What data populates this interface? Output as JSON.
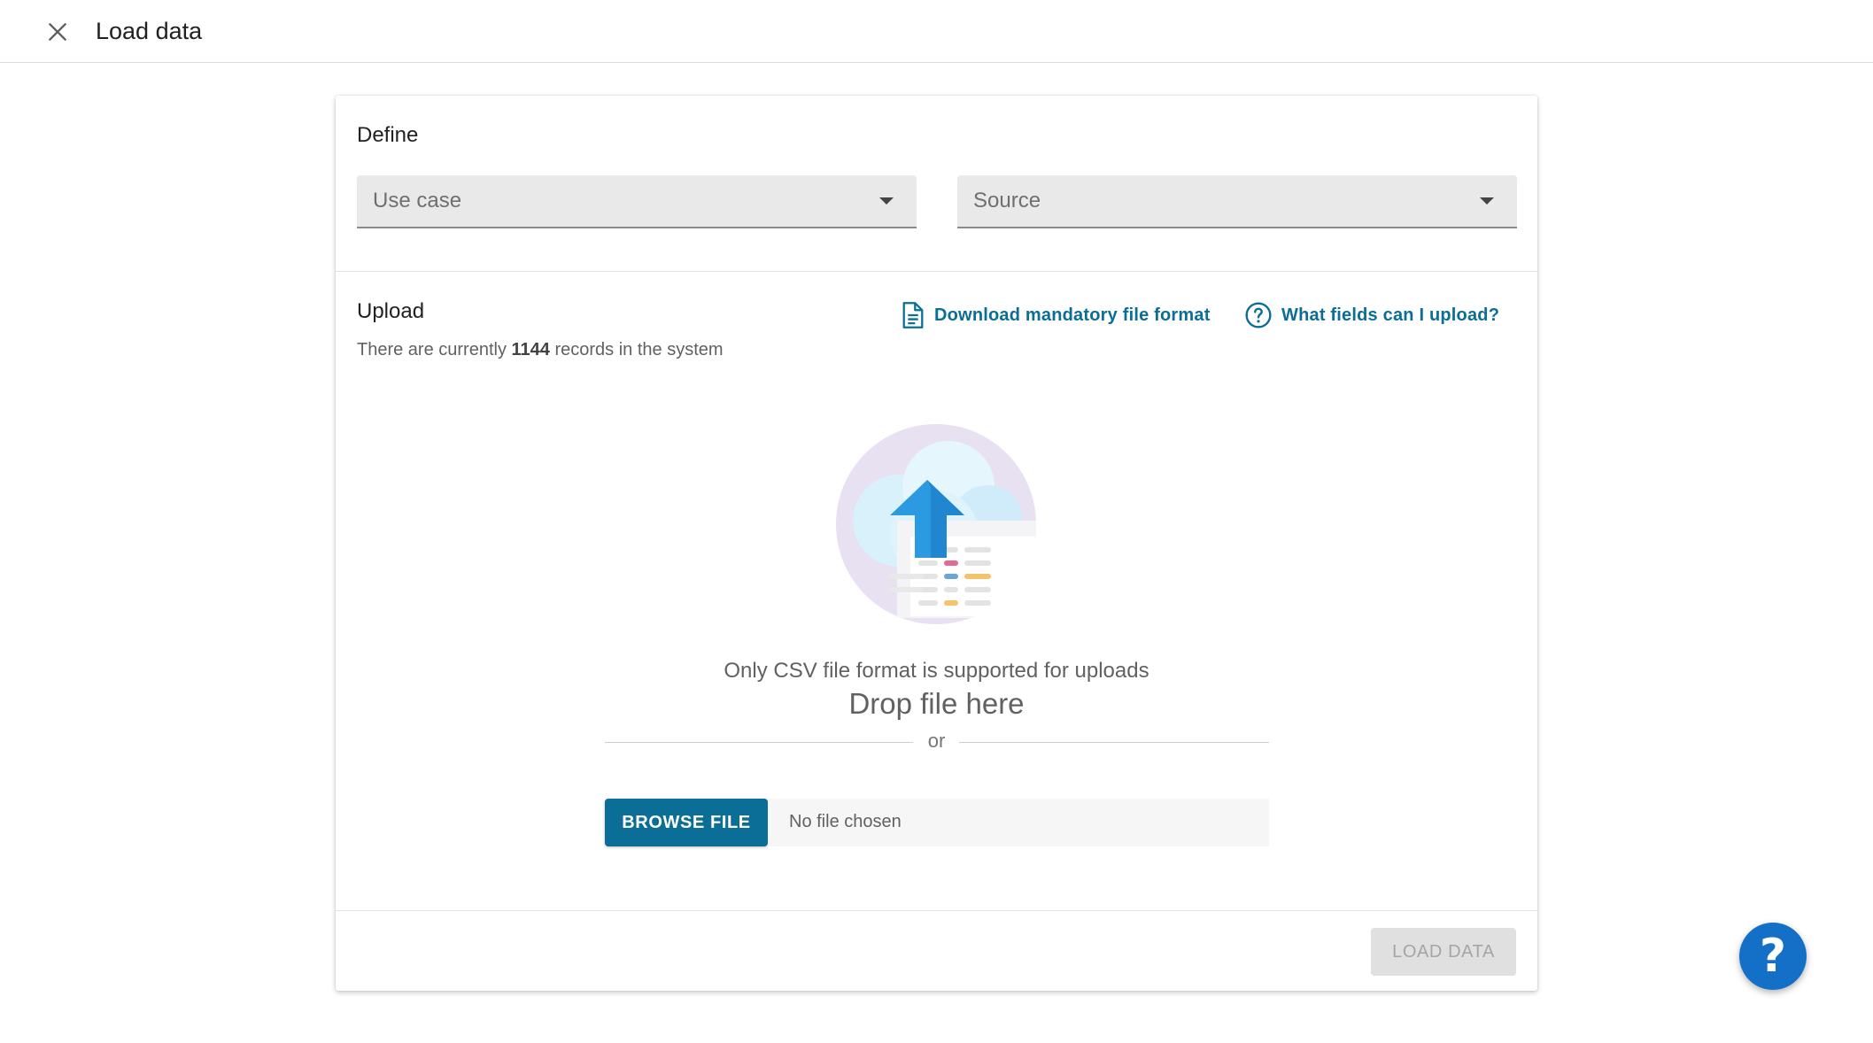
{
  "header": {
    "title": "Load data",
    "close_icon": "close-icon"
  },
  "define": {
    "title": "Define",
    "use_case_placeholder": "Use case",
    "source_placeholder": "Source"
  },
  "upload": {
    "title": "Upload",
    "records_prefix": "There are currently",
    "records_count": "1144",
    "records_suffix": "records in the system",
    "download_link": "Download mandatory file format",
    "fields_link": "What fields can I upload?",
    "csv_note": "Only CSV file format is supported for uploads",
    "drop_text": "Drop file here",
    "or_text": "or",
    "browse_button": "BROWSE FILE",
    "file_status": "No file chosen"
  },
  "footer": {
    "load_button": "LOAD DATA"
  },
  "help": {
    "fab_symbol": "?"
  },
  "colors": {
    "accent": "#0a6e96",
    "fab": "#1470c7"
  }
}
